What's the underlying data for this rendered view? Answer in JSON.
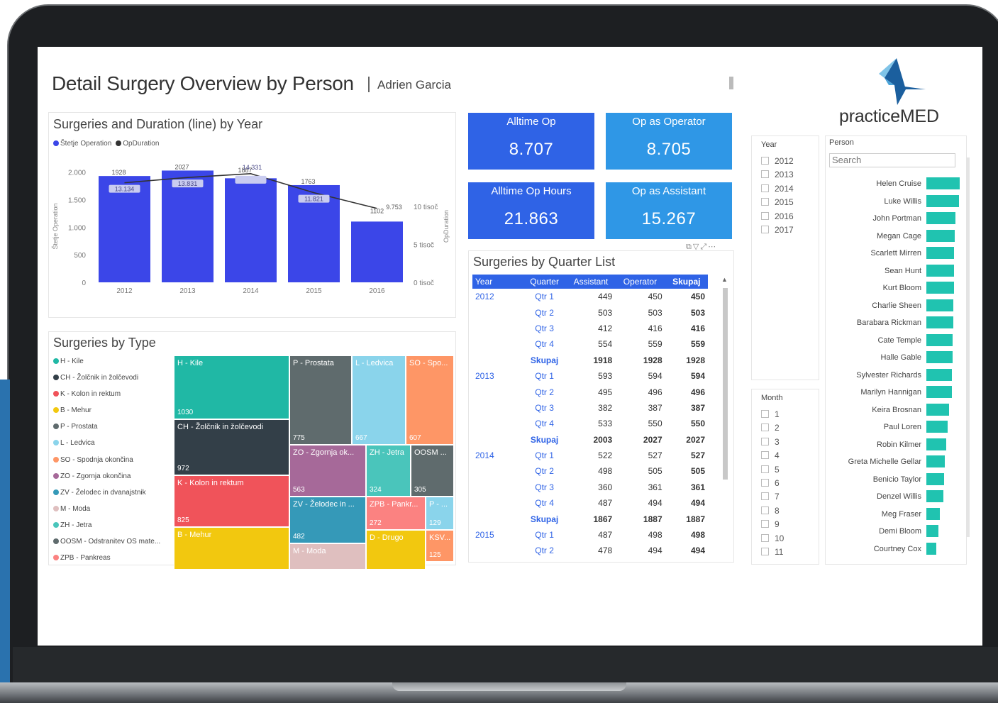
{
  "report": {
    "title": "Detail Surgery Overview by Person",
    "subtitle": "Adrien Garcia"
  },
  "logo": {
    "text": "practiceMED"
  },
  "kpis": [
    {
      "label": "Alltime Op",
      "value": "8.707",
      "color": "#2f63e6"
    },
    {
      "label": "Op as Operator",
      "value": "8.705",
      "color": "#2f97e6"
    },
    {
      "label": "Alltime Op Hours",
      "value": "21.863",
      "color": "#2f63e6"
    },
    {
      "label": "Op as Assistant",
      "value": "15.267",
      "color": "#2f97e6"
    }
  ],
  "chart_data": {
    "type": "bar",
    "title": "Surgeries and Duration (line) by Year",
    "legend": [
      {
        "name": "Štetje Operation",
        "color": "#3b46e8"
      },
      {
        "name": "OpDuration",
        "color": "#333333"
      }
    ],
    "categories": [
      "2012",
      "2013",
      "2014",
      "2015",
      "2016"
    ],
    "series": [
      {
        "name": "Štetje Operation",
        "values": [
          1928,
          2027,
          1887,
          1763,
          1102
        ],
        "labels": [
          "1928",
          "2027",
          "1887",
          "1763",
          "1102"
        ]
      },
      {
        "name": "OpDuration",
        "values": [
          13134,
          13831,
          14331,
          11821,
          9753
        ],
        "labels": [
          "13.134",
          "13.831",
          "14.331",
          "11.821",
          "9.753"
        ]
      }
    ],
    "ylabel": "Štetje Operation",
    "y2label": "OpDuration",
    "ylim": [
      0,
      2200
    ],
    "y2lim": [
      0,
      16000
    ],
    "yticks": [
      "2.000",
      "1.500",
      "1.000",
      "500",
      "0"
    ],
    "ytick_values": [
      2000,
      1500,
      1000,
      500,
      0
    ],
    "y2ticks": [
      "10 tisoč",
      "5 tisoč",
      "0 tisoč"
    ],
    "y2tick_values": [
      10000,
      5000,
      0
    ]
  },
  "table": {
    "title": "Surgeries by Quarter List",
    "columns": [
      "Year",
      "Quarter",
      "Assistant",
      "Operator",
      "Skupaj"
    ],
    "rows": [
      {
        "year": "2012",
        "quarter": "Qtr 1",
        "assistant": "449",
        "operator": "450",
        "total": "450"
      },
      {
        "year": "",
        "quarter": "Qtr 2",
        "assistant": "503",
        "operator": "503",
        "total": "503"
      },
      {
        "year": "",
        "quarter": "Qtr 3",
        "assistant": "412",
        "operator": "416",
        "total": "416"
      },
      {
        "year": "",
        "quarter": "Qtr 4",
        "assistant": "554",
        "operator": "559",
        "total": "559"
      },
      {
        "year": "",
        "quarter": "Skupaj",
        "assistant": "1918",
        "operator": "1928",
        "total": "1928",
        "subtotal": true
      },
      {
        "year": "2013",
        "quarter": "Qtr 1",
        "assistant": "593",
        "operator": "594",
        "total": "594"
      },
      {
        "year": "",
        "quarter": "Qtr 2",
        "assistant": "495",
        "operator": "496",
        "total": "496"
      },
      {
        "year": "",
        "quarter": "Qtr 3",
        "assistant": "382",
        "operator": "387",
        "total": "387"
      },
      {
        "year": "",
        "quarter": "Qtr 4",
        "assistant": "533",
        "operator": "550",
        "total": "550"
      },
      {
        "year": "",
        "quarter": "Skupaj",
        "assistant": "2003",
        "operator": "2027",
        "total": "2027",
        "subtotal": true
      },
      {
        "year": "2014",
        "quarter": "Qtr 1",
        "assistant": "522",
        "operator": "527",
        "total": "527"
      },
      {
        "year": "",
        "quarter": "Qtr 2",
        "assistant": "498",
        "operator": "505",
        "total": "505"
      },
      {
        "year": "",
        "quarter": "Qtr 3",
        "assistant": "360",
        "operator": "361",
        "total": "361"
      },
      {
        "year": "",
        "quarter": "Qtr 4",
        "assistant": "487",
        "operator": "494",
        "total": "494"
      },
      {
        "year": "",
        "quarter": "Skupaj",
        "assistant": "1867",
        "operator": "1887",
        "total": "1887",
        "subtotal": true
      },
      {
        "year": "2015",
        "quarter": "Qtr 1",
        "assistant": "487",
        "operator": "498",
        "total": "498"
      },
      {
        "year": "",
        "quarter": "Qtr 2",
        "assistant": "478",
        "operator": "494",
        "total": "494"
      }
    ]
  },
  "treemap": {
    "title": "Surgeries by Type",
    "legend": [
      {
        "label": "H - Kile",
        "color": "#20b8a5"
      },
      {
        "label": "CH - Žolčnik in žolčevodi",
        "color": "#333f48"
      },
      {
        "label": "K - Kolon in rektum",
        "color": "#f0535a"
      },
      {
        "label": "B - Mehur",
        "color": "#f2c80f"
      },
      {
        "label": "P - Prostata",
        "color": "#5f6b6d"
      },
      {
        "label": "L - Ledvica",
        "color": "#8ad4eb"
      },
      {
        "label": "SO - Spodnja okončina",
        "color": "#fe9666"
      },
      {
        "label": "ZO - Zgornja okončina",
        "color": "#a66999"
      },
      {
        "label": "ZV - Želodec in dvanajstnik",
        "color": "#3599b8"
      },
      {
        "label": "M - Moda",
        "color": "#dfbfbf"
      },
      {
        "label": "ZH - Jetra",
        "color": "#4ac5bb"
      },
      {
        "label": "OOSM - Odstranitev OS mate...",
        "color": "#5f6b6d"
      },
      {
        "label": "ZPB - Pankreas",
        "color": "#fb8281"
      }
    ],
    "tiles": [
      {
        "label": "H - Kile",
        "value": "1030",
        "color": "#20b8a5"
      },
      {
        "label": "CH - Žolčnik in žolčevodi",
        "value": "972",
        "color": "#333f48"
      },
      {
        "label": "K - Kolon in rektum",
        "value": "825",
        "color": "#f0535a"
      },
      {
        "label": "B - Mehur",
        "value": "",
        "color": "#f2c80f"
      },
      {
        "label": "P - Prostata",
        "value": "775",
        "color": "#5f6b6d"
      },
      {
        "label": "L - Ledvica",
        "value": "667",
        "color": "#8ad4eb"
      },
      {
        "label": "SO - Spo...",
        "value": "607",
        "color": "#fe9666"
      },
      {
        "label": "ZO - Zgornja ok...",
        "value": "563",
        "color": "#a66999"
      },
      {
        "label": "ZH - Jetra",
        "value": "324",
        "color": "#4ac5bb"
      },
      {
        "label": "OOSM ...",
        "value": "305",
        "color": "#5f6b6d"
      },
      {
        "label": "ZV - Želodec in ...",
        "value": "482",
        "color": "#3599b8"
      },
      {
        "label": "ZPB - Pankr...",
        "value": "272",
        "color": "#fb8281"
      },
      {
        "label": "P - ...",
        "value": "129",
        "color": "#8ad4eb"
      },
      {
        "label": "M - Moda",
        "value": "",
        "color": "#dfbfbf"
      },
      {
        "label": "D - Drugo",
        "value": "",
        "color": "#f2c80f"
      },
      {
        "label": "KSV...",
        "value": "125",
        "color": "#fe9666"
      }
    ]
  },
  "year_slicer": {
    "title": "Year",
    "items": [
      "2012",
      "2013",
      "2014",
      "2015",
      "2016",
      "2017"
    ]
  },
  "month_slicer": {
    "title": "Month",
    "items": [
      "1",
      "2",
      "3",
      "4",
      "5",
      "6",
      "7",
      "8",
      "9",
      "10",
      "11"
    ]
  },
  "person_slicer": {
    "title": "Person",
    "search_placeholder": "Search",
    "people": [
      {
        "name": "Helen Cruise",
        "value": 1.0
      },
      {
        "name": "Luke Willis",
        "value": 0.98
      },
      {
        "name": "John Portman",
        "value": 0.88
      },
      {
        "name": "Megan Cage",
        "value": 0.86
      },
      {
        "name": "Scarlett Mirren",
        "value": 0.84
      },
      {
        "name": "Sean Hunt",
        "value": 0.83
      },
      {
        "name": "Kurt Bloom",
        "value": 0.82
      },
      {
        "name": "Charlie Sheen",
        "value": 0.81
      },
      {
        "name": "Barabara Rickman",
        "value": 0.8
      },
      {
        "name": "Cate Temple",
        "value": 0.79
      },
      {
        "name": "Halle Gable",
        "value": 0.78
      },
      {
        "name": "Sylvester Richards",
        "value": 0.77
      },
      {
        "name": "Marilyn Hannigan",
        "value": 0.76
      },
      {
        "name": "Keira Brosnan",
        "value": 0.68
      },
      {
        "name": "Paul Loren",
        "value": 0.64
      },
      {
        "name": "Robin Kilmer",
        "value": 0.6
      },
      {
        "name": "Greta Michelle Gellar",
        "value": 0.56
      },
      {
        "name": "Benicio Taylor",
        "value": 0.54
      },
      {
        "name": "Denzel Willis",
        "value": 0.52
      },
      {
        "name": "Meg Fraser",
        "value": 0.4
      },
      {
        "name": "Demi Bloom",
        "value": 0.36
      },
      {
        "name": "Courtney Cox",
        "value": 0.3
      }
    ]
  }
}
